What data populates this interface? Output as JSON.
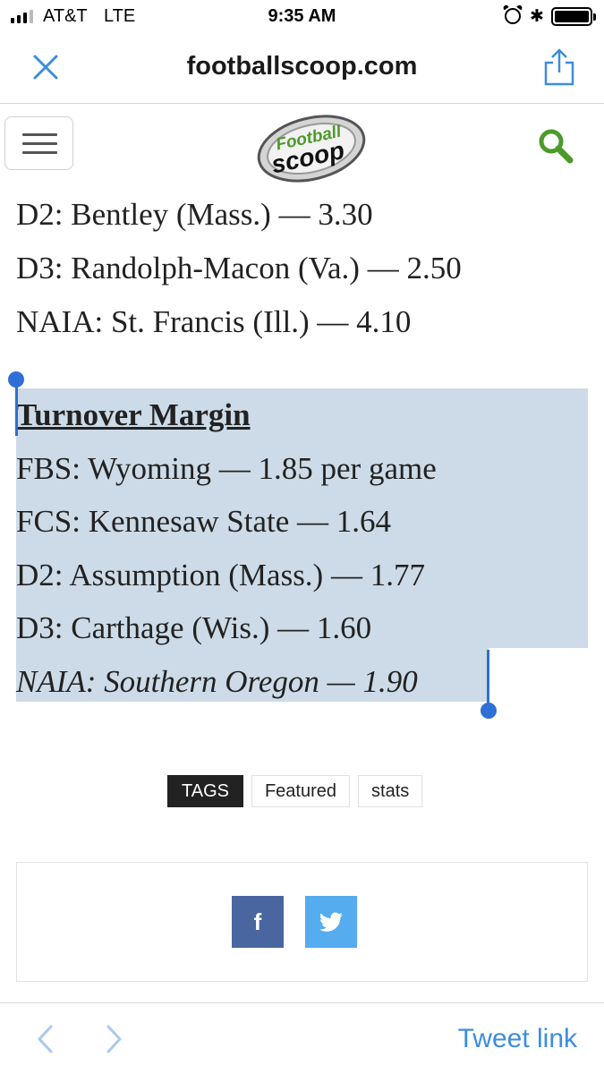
{
  "status_bar": {
    "carrier": "AT&T",
    "network": "LTE",
    "time": "9:35 AM",
    "signal_bars_filled": 3,
    "signal_bars_total": 4,
    "icons": [
      "alarm-icon",
      "bluetooth-icon",
      "battery-icon"
    ],
    "bluetooth_glyph": "✱"
  },
  "browser": {
    "domain": "footballscoop.com",
    "close_icon": "close-icon",
    "share_icon": "share-icon"
  },
  "site_header": {
    "menu_icon": "hamburger-icon",
    "logo_text_top": "Football",
    "logo_text_bottom": "scoop",
    "search_icon": "search-icon",
    "accent_color": "#4c9a2a"
  },
  "article": {
    "lines_above": [
      "D2: Bentley (Mass.) — 3.30",
      "D3: Randolph-Macon (Va.) — 2.50",
      "NAIA: St. Francis (Ill.) — 4.10"
    ],
    "selected_heading": "Turnover Margin",
    "selected_lines": [
      "FBS: Wyoming — 1.85 per game",
      "FCS: Kennesaw State — 1.64",
      "D2: Assumption (Mass.) — 1.77",
      "D3: Carthage (Wis.) — 1.60"
    ],
    "selected_last_line": "NAIA: Southern Oregon — 1.90",
    "selection_color": "#cddbe8",
    "handle_color": "#2f6fd6"
  },
  "tags": {
    "label": "TAGS",
    "items": [
      "Featured",
      "stats"
    ]
  },
  "share": {
    "facebook_glyph": "f",
    "facebook_color": "#4a66a0",
    "twitter_color": "#55acee"
  },
  "toolbar": {
    "back_icon": "chevron-left-icon",
    "forward_icon": "chevron-right-icon",
    "tweet_link_label": "Tweet link",
    "link_color": "#3c8ddb"
  }
}
